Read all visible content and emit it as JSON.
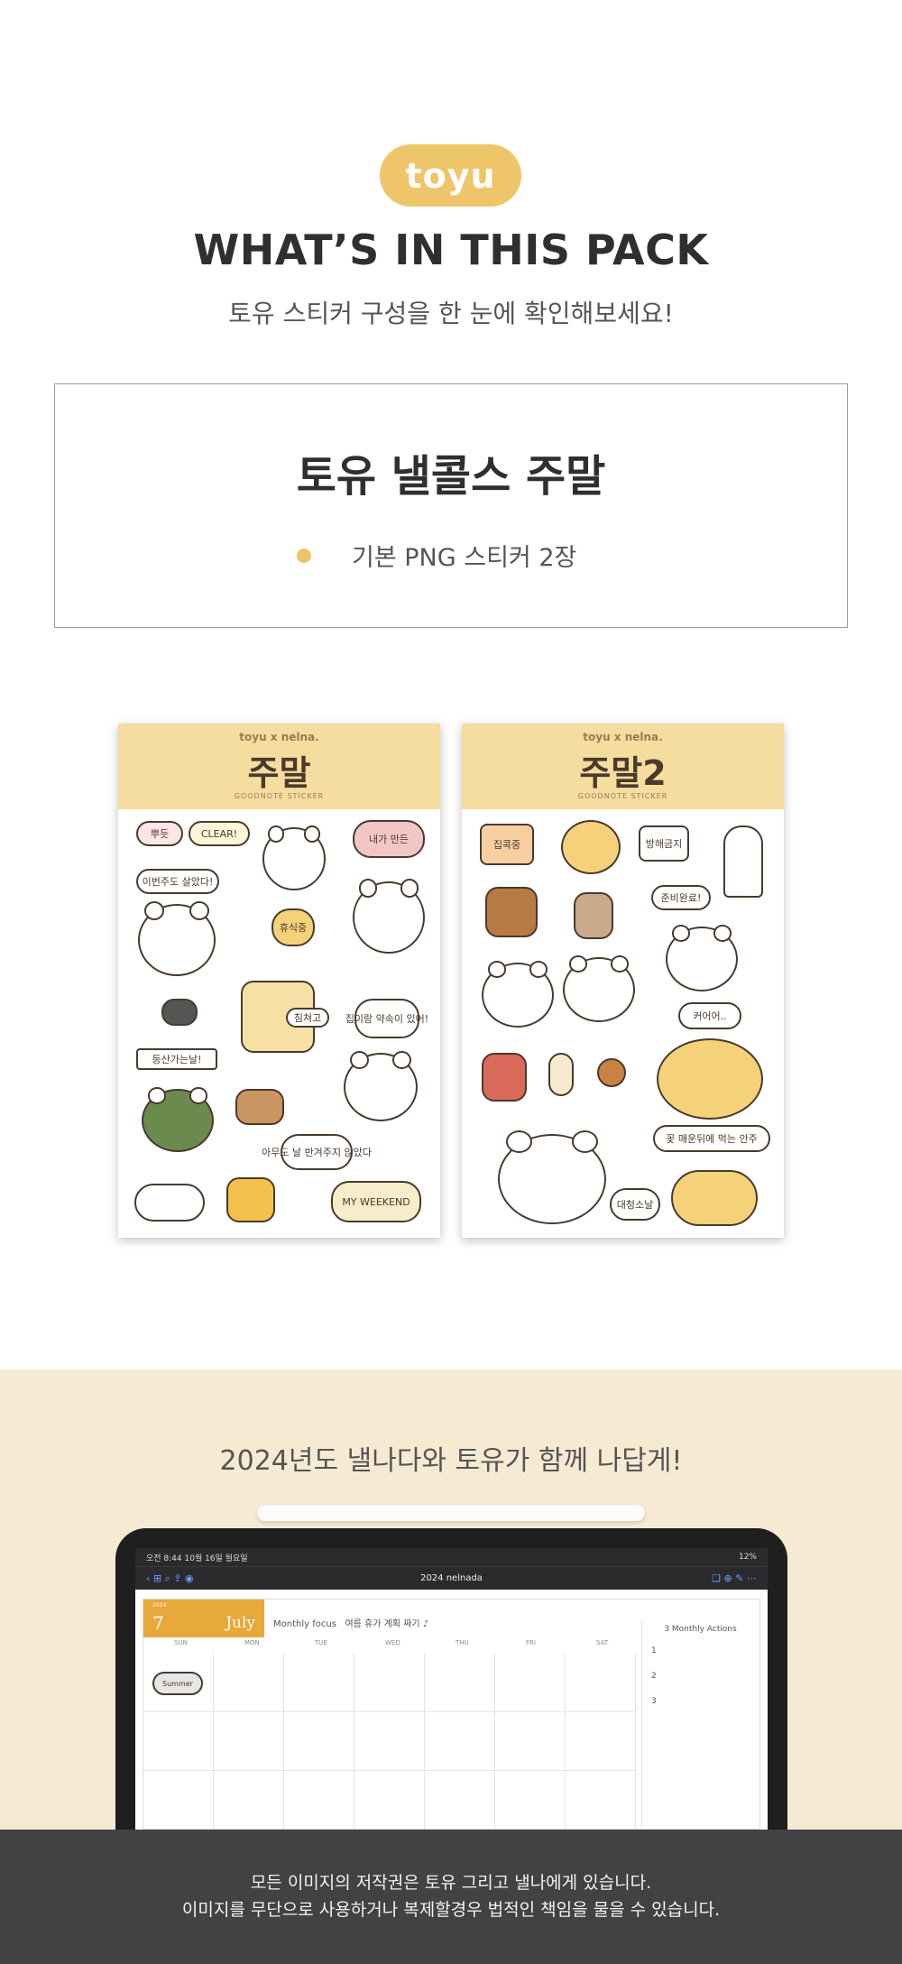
{
  "header": {
    "logo_text": "toyu",
    "headline": "WHAT’S IN THIS PACK",
    "subtitle": "토유 스티커 구성을 한 눈에 확인해보세요!"
  },
  "pack": {
    "title": "토유 낼콜스 주말",
    "items": [
      "기본 PNG 스티커 2장"
    ],
    "bullet_color": "#efc56a"
  },
  "sheets": [
    {
      "brand": "toyu x nelna.",
      "title": "주말",
      "subtitle": "GOODNOTE STICKER",
      "stickers": [
        "뿌듯",
        "CLEAR!",
        "내가 만든",
        "이번주도 살았다!",
        "휴식중",
        "집이랑 약속이 있어!",
        "침쳐고",
        "등산가는날!",
        "아무도 날 반겨주지 않았다",
        "MY WEEKEND"
      ]
    },
    {
      "brand": "toyu x nelna.",
      "title": "주말2",
      "subtitle": "GOODNOTE STICKER",
      "stickers": [
        "집콕중",
        "방해금지",
        "준비완료!",
        "커어어..",
        "꽃 매운뒤에 먹는 안주",
        "대청소날"
      ]
    }
  ],
  "promo": {
    "title": "2024년도 낼나다와 토유가 함께 나답게!"
  },
  "ipad": {
    "status_time": "오전 8:44  10월 16일 월요일",
    "status_right": "12%",
    "doc_title": "2024 nelnada",
    "month_number": "7",
    "month_name": "July",
    "year": "2024",
    "monthly_focus_label": "Monthly focus",
    "monthly_focus_value": "여름 휴가 계획 짜기 ♪",
    "weekdays": [
      "SUN",
      "MON",
      "TUE",
      "WED",
      "THU",
      "FRI",
      "SAT"
    ],
    "actions_title": "3 Monthly Actions",
    "actions": [
      "1",
      "2",
      "3"
    ],
    "sticker_label": "Summer"
  },
  "footer": {
    "line1": "모든 이미지의 저작권은 토유 그리고 낼나에게 있습니다.",
    "line2": "이미지를 무단으로 사용하거나 복제할경우 법적인 책임을 물을 수 있습니다."
  }
}
